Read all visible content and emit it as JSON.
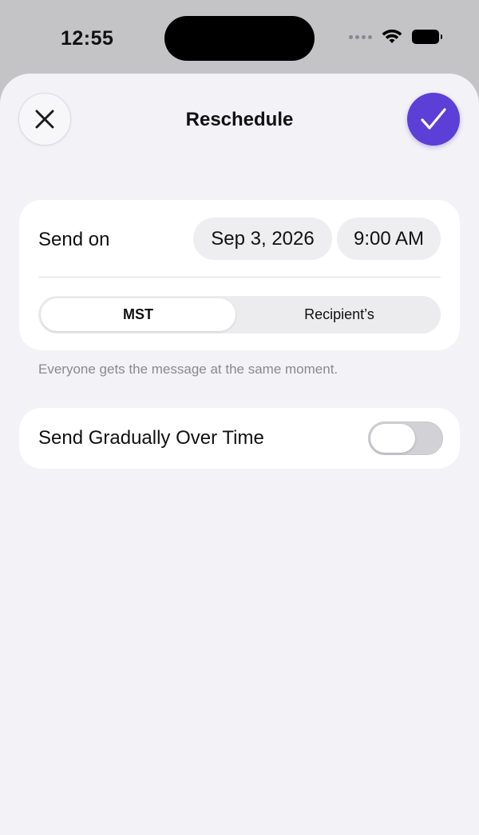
{
  "status_bar": {
    "time": "12:55",
    "icons": [
      "cellular-dots-icon",
      "wifi-icon",
      "battery-icon"
    ]
  },
  "sheet": {
    "title": "Reschedule",
    "close_icon": "close-icon",
    "confirm_icon": "checkmark-icon",
    "accent_color": "#5b3fd6"
  },
  "schedule": {
    "send_on_label": "Send on",
    "date": "Sep 3, 2026",
    "time": "9:00 AM",
    "timezone_options": [
      "MST",
      "Recipient’s"
    ],
    "timezone_selected": "MST",
    "helper_text": "Everyone gets the message at the same moment."
  },
  "gradual": {
    "label": "Send Gradually Over Time",
    "enabled": false
  }
}
